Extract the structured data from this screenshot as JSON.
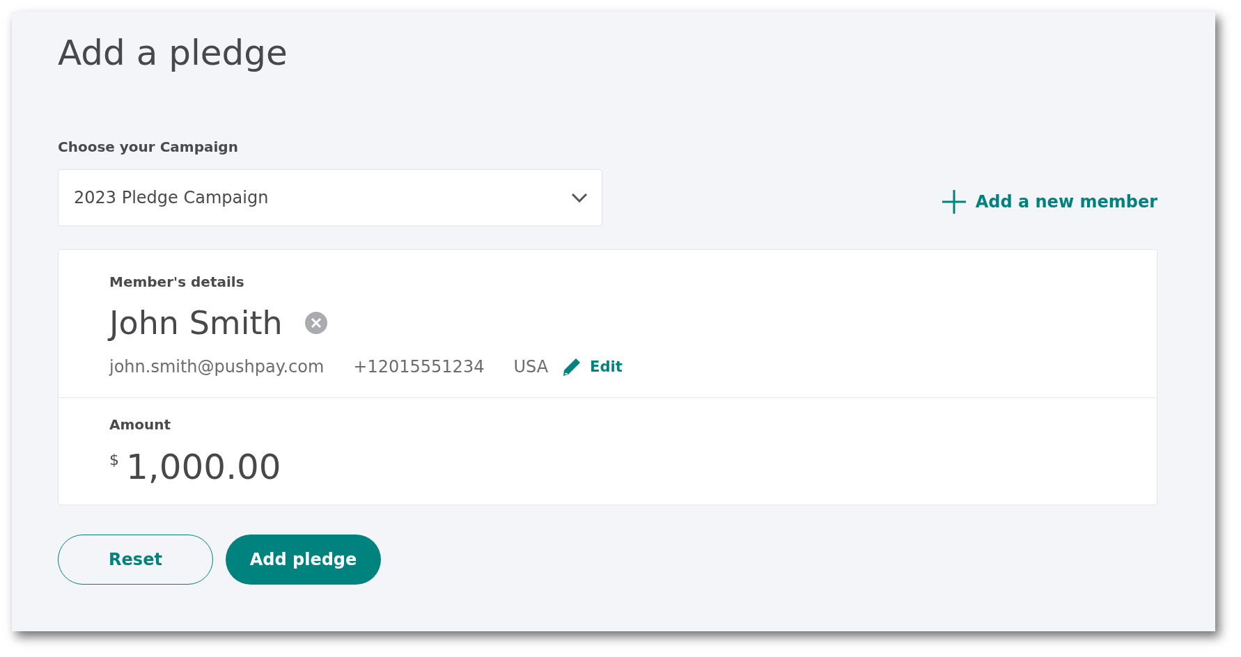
{
  "page": {
    "title": "Add a pledge"
  },
  "campaign": {
    "label": "Choose your Campaign",
    "value": "2023 Pledge Campaign"
  },
  "add_member_link": "Add a new member",
  "member": {
    "heading": "Member's details",
    "name": "John Smith",
    "email": "john.smith@pushpay.com",
    "phone": "+12015551234",
    "country": "USA",
    "edit_label": "Edit"
  },
  "amount": {
    "label": "Amount",
    "currency": "$",
    "value": "1,000.00"
  },
  "buttons": [
    {
      "label": "Reset",
      "kind": "secondary"
    },
    {
      "label": "Add pledge",
      "kind": "primary"
    }
  ]
}
